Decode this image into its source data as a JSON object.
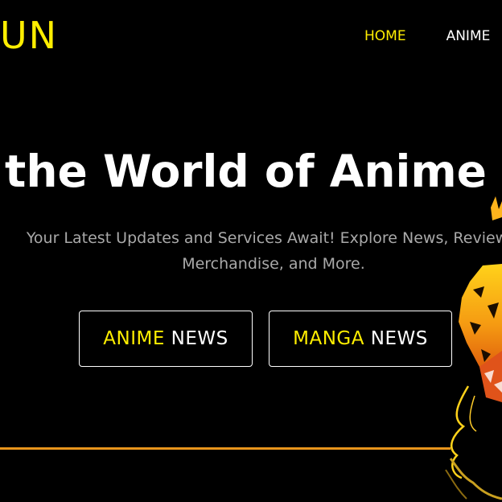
{
  "header": {
    "logo_text": "UN",
    "nav": {
      "home": "HOME",
      "anime": "ANIME"
    }
  },
  "hero": {
    "title": "Dive into the World of Anime",
    "subtitle_line1": "Your Latest Updates and Services Await! Explore News, Reviews,",
    "subtitle_line2": "Merchandise, and More.",
    "buttons": {
      "anime_accent": "ANIME",
      "anime_plain": " NEWS",
      "manga_accent": "MANGA",
      "manga_plain": " NEWS"
    }
  },
  "colors": {
    "accent": "#ffee00",
    "background": "#000000",
    "divider": "#e8951c"
  },
  "icons": {
    "hero_art": "tiger-mask-illustration"
  }
}
